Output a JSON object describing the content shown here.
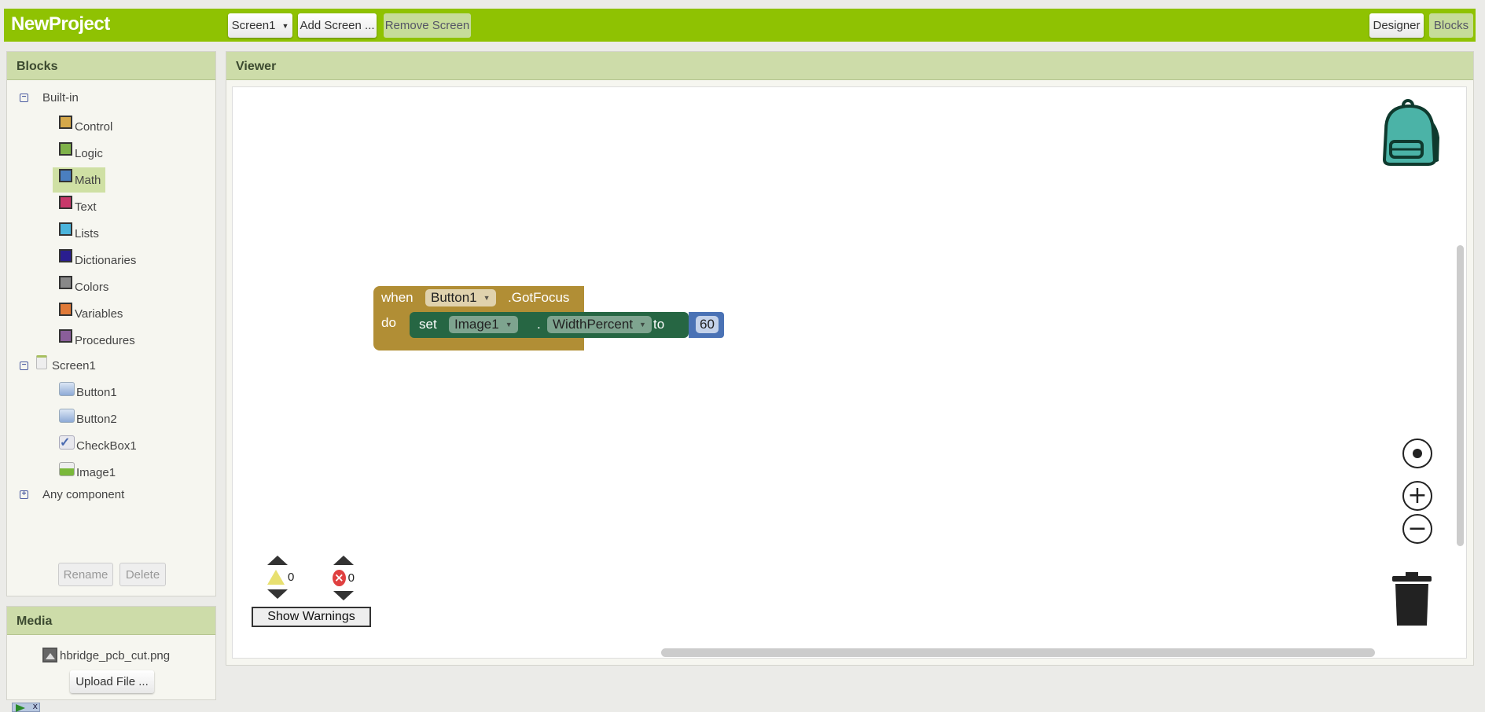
{
  "app": {
    "title": "NewProject"
  },
  "toolbar": {
    "screen_select": "Screen1",
    "add_screen": "Add Screen ...",
    "remove_screen": "Remove Screen",
    "designer": "Designer",
    "blocks": "Blocks"
  },
  "blocks_panel": {
    "title": "Blocks",
    "builtin": {
      "label": "Built-in",
      "items": [
        {
          "label": "Control",
          "color": "#d5a84a"
        },
        {
          "label": "Logic",
          "color": "#7fb24a"
        },
        {
          "label": "Math",
          "color": "#4a7fc0",
          "selected": true
        },
        {
          "label": "Text",
          "color": "#c8386a"
        },
        {
          "label": "Lists",
          "color": "#4ab4dc"
        },
        {
          "label": "Dictionaries",
          "color": "#2a1e90"
        },
        {
          "label": "Colors",
          "color": "#888888"
        },
        {
          "label": "Variables",
          "color": "#e07a38"
        },
        {
          "label": "Procedures",
          "color": "#8a5e9a"
        }
      ]
    },
    "screen": {
      "label": "Screen1",
      "components": [
        {
          "label": "Button1",
          "icon": "button-icon"
        },
        {
          "label": "Button2",
          "icon": "button-icon"
        },
        {
          "label": "CheckBox1",
          "icon": "checkbox-icon"
        },
        {
          "label": "Image1",
          "icon": "image-icon"
        }
      ]
    },
    "any_component": "Any component",
    "rename": "Rename",
    "delete": "Delete"
  },
  "media": {
    "title": "Media",
    "file": "hbridge_pcb_cut.png",
    "upload": "Upload File ..."
  },
  "viewer": {
    "title": "Viewer",
    "event_block": {
      "when": "when",
      "component": "Button1",
      "event": ".GotFocus",
      "do": "do",
      "color": "#b18e35"
    },
    "set_block": {
      "set": "set",
      "component": "Image1",
      "dot": ".",
      "property": "WidthPercent",
      "to": "to",
      "color": "#266643"
    },
    "number_block": {
      "value": "60",
      "color": "#4a72b5"
    },
    "warnings_count": "0",
    "errors_count": "0",
    "show_warnings": "Show Warnings"
  }
}
